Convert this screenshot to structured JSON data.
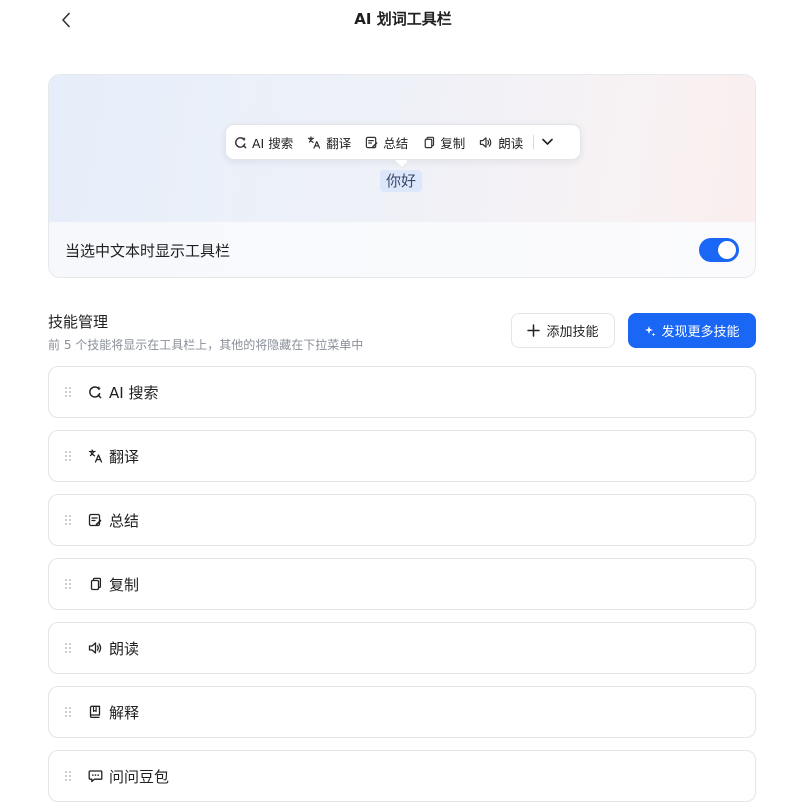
{
  "header": {
    "title": "AI 划词工具栏"
  },
  "preview": {
    "toolbar": [
      {
        "icon": "ai-search-icon",
        "label": "AI 搜索"
      },
      {
        "icon": "translate-icon",
        "label": "翻译"
      },
      {
        "icon": "summary-icon",
        "label": "总结"
      },
      {
        "icon": "copy-icon",
        "label": "复制"
      },
      {
        "icon": "read-aloud-icon",
        "label": "朗读"
      }
    ],
    "more_icon": "chevron-down-icon",
    "selected_text": "你好"
  },
  "show_toolbar": {
    "label": "当选中文本时显示工具栏",
    "enabled": true,
    "accent": "#1a66f5"
  },
  "skills": {
    "title": "技能管理",
    "description": "前 5 个技能将显示在工具栏上，其他的将隐藏在下拉菜单中",
    "add_label": "添加技能",
    "discover_label": "发现更多技能",
    "items": [
      {
        "icon": "ai-search-icon",
        "label": "AI 搜索"
      },
      {
        "icon": "translate-icon",
        "label": "翻译"
      },
      {
        "icon": "summary-icon",
        "label": "总结"
      },
      {
        "icon": "copy-icon",
        "label": "复制"
      },
      {
        "icon": "read-aloud-icon",
        "label": "朗读"
      },
      {
        "icon": "book-icon",
        "label": "解释"
      },
      {
        "icon": "chat-icon",
        "label": "问问豆包"
      }
    ]
  }
}
